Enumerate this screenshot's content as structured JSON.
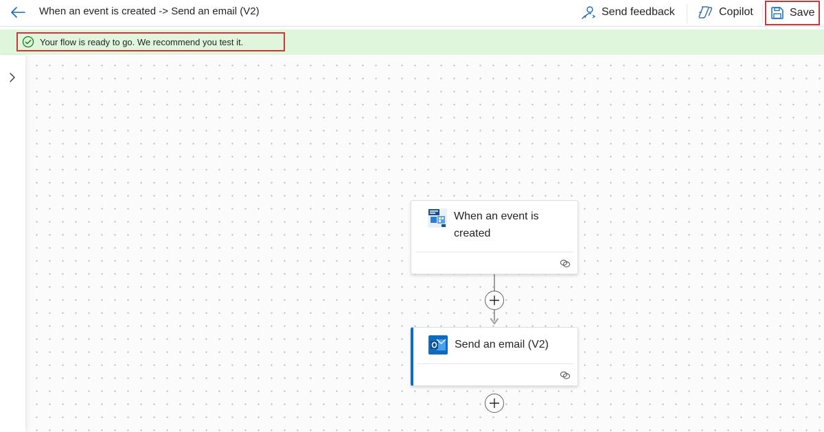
{
  "header": {
    "flow_title": "When an event is created -> Send an email (V2)",
    "send_feedback_label": "Send feedback",
    "copilot_label": "Copilot",
    "save_label": "Save"
  },
  "banner": {
    "message": "Your flow is ready to go. We recommend you test it."
  },
  "canvas": {
    "trigger_card": {
      "title": "When an event is created",
      "icon": "event-connector-icon"
    },
    "action_card": {
      "title": "Send an email (V2)",
      "icon": "outlook-icon"
    }
  },
  "colors": {
    "banner_bg": "#dff6dd",
    "highlight_border": "#d13438",
    "accent": "#0f6cbd",
    "success": "#107c10"
  }
}
